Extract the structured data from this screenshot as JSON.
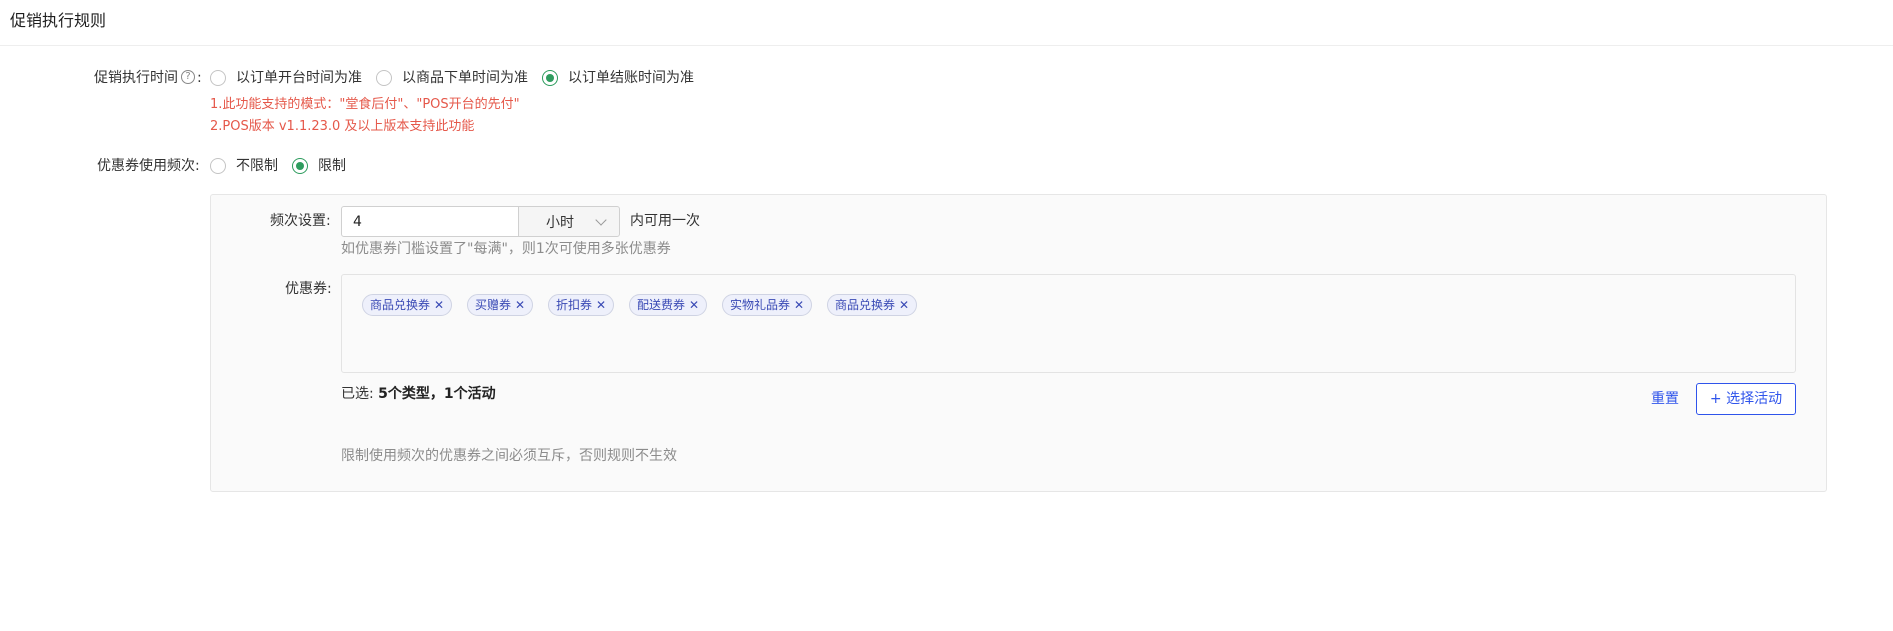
{
  "page": {
    "title": "促销执行规则"
  },
  "exec_time": {
    "label": "促销执行时间",
    "help_icon": "?",
    "colon": ":",
    "options": [
      {
        "label": "以订单开台时间为准",
        "checked": false
      },
      {
        "label": "以商品下单时间为准",
        "checked": false
      },
      {
        "label": "以订单结账时间为准",
        "checked": true
      }
    ],
    "notes": [
      "1.此功能支持的模式：\"堂食后付\"、\"POS开台的先付\"",
      "2.POS版本 v1.1.23.0 及以上版本支持此功能"
    ]
  },
  "coupon_frequency": {
    "label": "优惠券使用频次",
    "colon": ":",
    "options": [
      {
        "label": "不限制",
        "checked": false
      },
      {
        "label": "限制",
        "checked": true
      }
    ],
    "settings": {
      "freq_label": "频次设置",
      "colon": ":",
      "value": "4",
      "unit": "小时",
      "suffix": "内可用一次",
      "hint": "如优惠券门槛设置了\"每满\"，则1次可使用多张优惠券",
      "coupon_label": "优惠券",
      "coupons": [
        "商品兑换券",
        "买赠券",
        "折扣券",
        "配送费券",
        "实物礼品券",
        "商品兑换券"
      ],
      "remove_glyph": "✕",
      "selected_prefix": "已选:",
      "selected_value": "5个类型，1个活动",
      "reset_label": "重置",
      "choose_label": "+ 选择活动",
      "footer_hint": "限制使用频次的优惠券之间必须互斥，否则规则不生效"
    }
  },
  "colors": {
    "accent_green": "#2e9c5e",
    "warning_red": "#e5584a",
    "link_blue": "#2f54eb"
  }
}
